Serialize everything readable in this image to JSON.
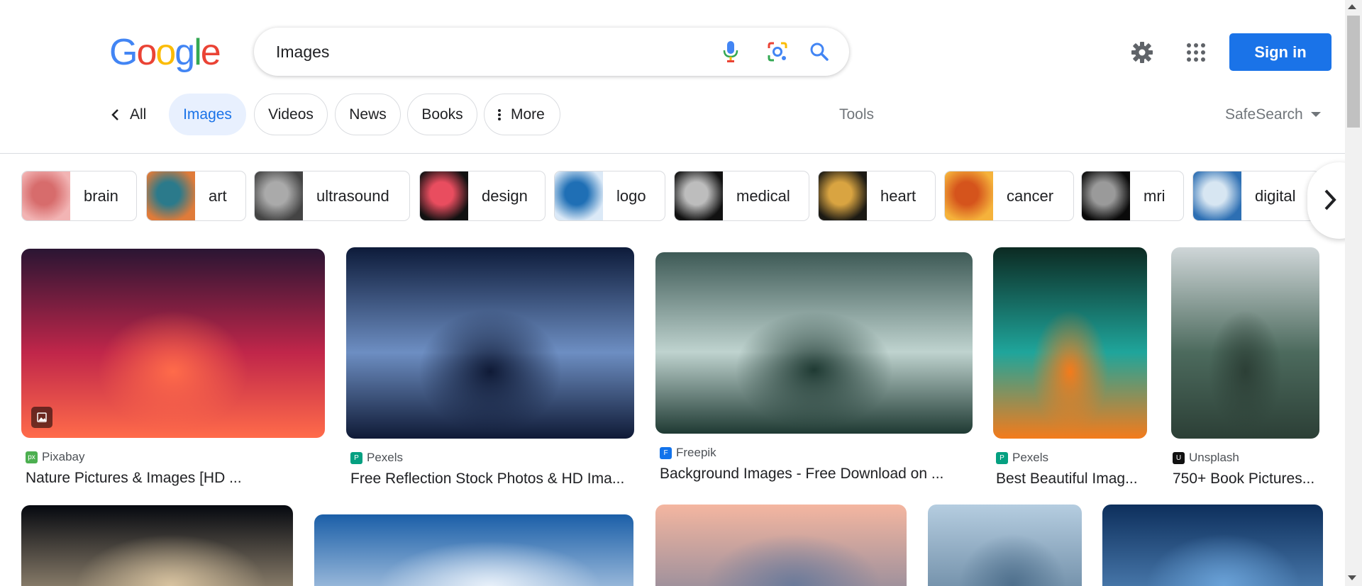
{
  "logo": {
    "letters": [
      "G",
      "o",
      "o",
      "g",
      "l",
      "e"
    ],
    "colors": [
      "#4285f4",
      "#ea4335",
      "#fbbc05",
      "#4285f4",
      "#34a853",
      "#ea4335"
    ]
  },
  "search": {
    "query": "Images"
  },
  "header": {
    "sign_in_label": "Sign in",
    "accent": "#1a73e8"
  },
  "tabs": {
    "all": "All",
    "images": "Images",
    "videos": "Videos",
    "news": "News",
    "books": "Books",
    "more": "More",
    "tools": "Tools",
    "safesearch": "SafeSearch"
  },
  "chips": [
    {
      "label": "brain",
      "colors": [
        "#f2b4b4",
        "#d76c6c"
      ]
    },
    {
      "label": "art",
      "colors": [
        "#e07b39",
        "#2b7a8b"
      ]
    },
    {
      "label": "ultrasound",
      "colors": [
        "#444",
        "#aaa"
      ]
    },
    {
      "label": "design",
      "colors": [
        "#111",
        "#e94d5f"
      ]
    },
    {
      "label": "logo",
      "colors": [
        "#dbe9f7",
        "#1f6fb5"
      ]
    },
    {
      "label": "medical",
      "colors": [
        "#111",
        "#bdbdbd"
      ]
    },
    {
      "label": "heart",
      "colors": [
        "#1c1a14",
        "#d9a441"
      ]
    },
    {
      "label": "cancer",
      "colors": [
        "#f5b23b",
        "#d5541c"
      ]
    },
    {
      "label": "mri",
      "colors": [
        "#0a0a0a",
        "#9a9a9a"
      ]
    },
    {
      "label": "digital",
      "colors": [
        "#2d6fb3",
        "#d7e6f2"
      ]
    }
  ],
  "results": [
    {
      "source": "Pixabay",
      "title": "Nature Pictures & Images [HD ...",
      "favicon_color": "#4caf50",
      "favicon_text": "px",
      "colors": [
        "#2a1533",
        "#c0264a",
        "#ff6b4a"
      ]
    },
    {
      "source": "Pexels",
      "title": "Free Reflection Stock Photos & HD Ima...",
      "favicon_color": "#05a081",
      "favicon_text": "P",
      "colors": [
        "#0d1b3a",
        "#6d8ec2",
        "#0f1a36"
      ]
    },
    {
      "source": "Freepik",
      "title": "Background Images - Free Download on ...",
      "favicon_color": "#1273eb",
      "favicon_text": "F",
      "colors": [
        "#3e5a56",
        "#bfd3cf",
        "#1f3a33"
      ]
    },
    {
      "source": "Pexels",
      "title": "Best Beautiful Imag...",
      "favicon_color": "#05a081",
      "favicon_text": "P",
      "colors": [
        "#0c2a22",
        "#1fa59b",
        "#f47b1b"
      ]
    },
    {
      "source": "Unsplash",
      "title": "750+ Book Pictures...",
      "favicon_color": "#111111",
      "favicon_text": "U",
      "colors": [
        "#cfd6d8",
        "#4c6a5d",
        "#2c3f36"
      ]
    }
  ],
  "row2": [
    {
      "colors": [
        "#05080f",
        "#d8c3a0"
      ]
    },
    {
      "colors": [
        "#1b5fa8",
        "#e9f1fa"
      ]
    },
    {
      "colors": [
        "#f4b6a0",
        "#6b7a9a"
      ]
    },
    {
      "colors": [
        "#b5cde0",
        "#4e6f8c"
      ]
    },
    {
      "colors": [
        "#0d2f5c",
        "#6aa2d8"
      ]
    }
  ]
}
